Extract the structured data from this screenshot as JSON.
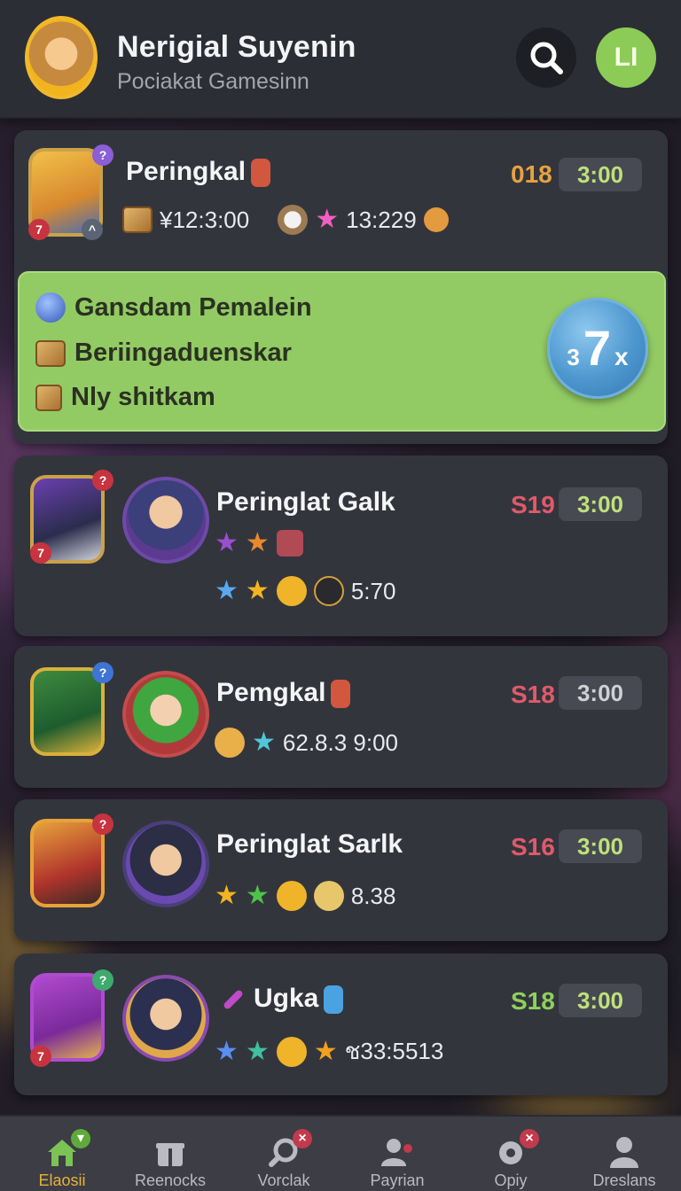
{
  "header": {
    "title": "Nerigial Suyenin",
    "subtitle": "Pociakat Gamesinn",
    "profile_initials": "LI",
    "search_icon": "search-icon"
  },
  "colors": {
    "accent_green": "#92cb64",
    "score_orange": "#e7a23f",
    "score_red": "#e05a6a",
    "score_green": "#8fd05c",
    "time_green": "#bfe07a",
    "card_bg": "#33353d"
  },
  "cards": [
    {
      "title": "Peringkal",
      "score": "018",
      "time": "3:00",
      "stat_1": "¥12:3:00",
      "stat_2": "13:229"
    },
    {
      "title": "Peringlat Galk",
      "score": "S19",
      "time": "3:00",
      "stat": "5:70"
    },
    {
      "title": "Pemgkal",
      "score": "S18",
      "time": "3:00",
      "stat": "62.8.3 9:00"
    },
    {
      "title": "Peringlat Sarlk",
      "score": "S16",
      "time": "3:00",
      "stat": "8.38"
    },
    {
      "title": "Ugka",
      "score": "S18",
      "time": "3:00",
      "stat": "ช33:5513"
    }
  ],
  "promo": {
    "items": [
      "Gansdam Pemalein",
      "Beriingaduenskar",
      "Nly shitkam"
    ],
    "multiplier_prefix": "3",
    "multiplier_value": "7",
    "multiplier_suffix": "x"
  },
  "nav": [
    {
      "label": "Elaosii",
      "icon": "home-icon"
    },
    {
      "label": "Reenocks",
      "icon": "gift-icon"
    },
    {
      "label": "Vorclak",
      "icon": "magnifier-icon"
    },
    {
      "label": "Payrian",
      "icon": "friends-icon"
    },
    {
      "label": "Opiy",
      "icon": "settings-icon"
    },
    {
      "label": "Dreslans",
      "icon": "profile-icon"
    }
  ]
}
